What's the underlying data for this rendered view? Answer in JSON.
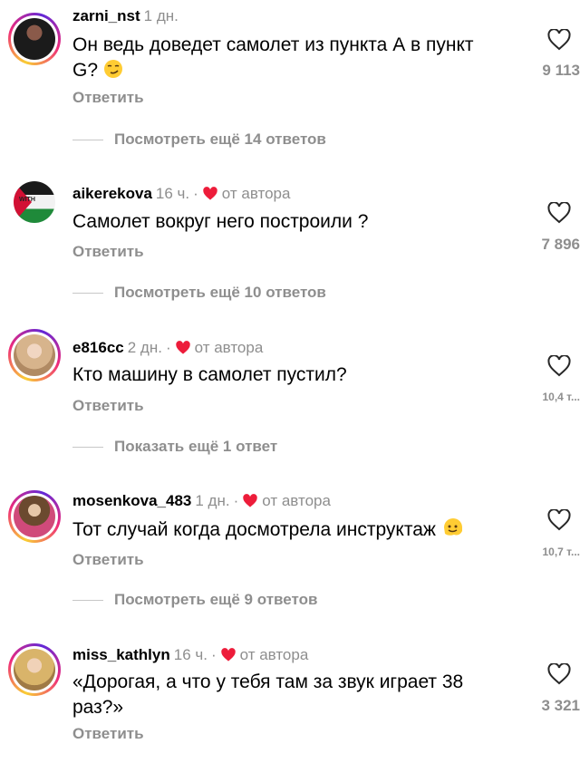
{
  "comments": [
    {
      "username": "zarni_nst",
      "time": "1 дн.",
      "author_liked": false,
      "text": "Он ведь доведет самолет из пункта А в пункт G?",
      "emoji": "smirk",
      "likes": "9 113",
      "reply_label": "Ответить",
      "more_label": "Посмотреть ещё 14 ответов"
    },
    {
      "username": "aikerekova",
      "time": "16 ч.",
      "author_liked": true,
      "author_label": "от автора",
      "avatar_text": [
        "STAND",
        "WITH",
        "PALESTINE"
      ],
      "text": "Самолет вокруг него построили ?",
      "likes": "7 896",
      "reply_label": "Ответить",
      "more_label": "Посмотреть ещё 10 ответов"
    },
    {
      "username": "e816cc",
      "time": "2 дн.",
      "author_liked": true,
      "author_label": "от автора",
      "text": "Кто машину в самолет пустил?",
      "likes": "10,4 т...",
      "reply_label": "Ответить",
      "more_label": "Показать ещё 1 ответ"
    },
    {
      "username": "mosenkova_483",
      "time": "1 дн.",
      "author_liked": true,
      "author_label": "от автора",
      "text": "Тот случай когда досмотрела инструктаж",
      "emoji": "melting",
      "likes": "10,7 т...",
      "reply_label": "Ответить",
      "more_label": "Посмотреть ещё 9 ответов"
    },
    {
      "username": "miss_kathlyn",
      "time": "16 ч.",
      "author_liked": true,
      "author_label": "от автора",
      "text": "«Дорогая, а что у тебя там за звук играет 38 раз?»",
      "likes": "3 321",
      "reply_label": "Ответить"
    }
  ],
  "colors": {
    "heart_red": "#ed1c3a",
    "gray": "#8e8e8e"
  }
}
